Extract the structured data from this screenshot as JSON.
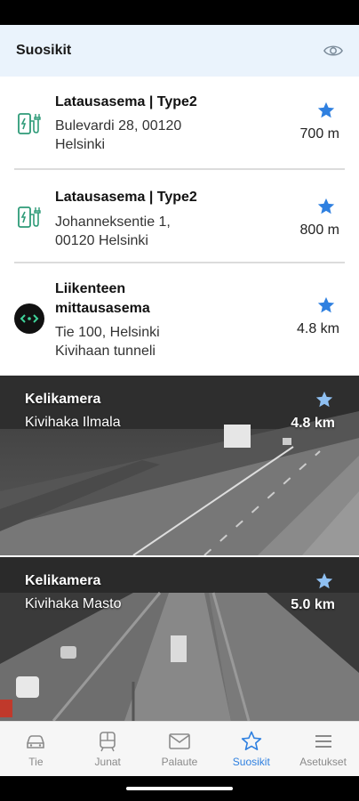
{
  "header": {
    "title": "Suosikit",
    "visibility_icon": "eye-icon"
  },
  "items": [
    {
      "title": "Latausasema | Type2",
      "address": [
        "Bulevardi 28, 00120",
        "Helsinki"
      ],
      "distance": "700 m",
      "icon": "ev-charger-icon"
    },
    {
      "title": "Latausasema | Type2",
      "address": [
        "Johanneksentie 1,",
        "00120 Helsinki"
      ],
      "distance": "800 m",
      "icon": "ev-charger-icon"
    },
    {
      "title": [
        "Liikenteen",
        "mittausasema"
      ],
      "address": [
        "Tie 100, Helsinki",
        "Kivihaan tunneli"
      ],
      "distance": "4.8 km",
      "icon": "measurement-station-icon"
    }
  ],
  "cameras": [
    {
      "title": "Kelikamera",
      "name": "Kivihaka Ilmala",
      "distance": "4.8 km"
    },
    {
      "title": "Kelikamera",
      "name": "Kivihaka Masto",
      "distance": "5.0 km"
    }
  ],
  "tabs": [
    {
      "label": "Tie",
      "icon": "car-icon"
    },
    {
      "label": "Junat",
      "icon": "train-icon"
    },
    {
      "label": "Palaute",
      "icon": "mail-icon"
    },
    {
      "label": "Suosikit",
      "icon": "star-icon",
      "active": true
    },
    {
      "label": "Asetukset",
      "icon": "menu-icon"
    }
  ],
  "colors": {
    "accent": "#2f80e0",
    "header_bg": "#eaf3fc",
    "charger_green": "#2e9b78"
  }
}
